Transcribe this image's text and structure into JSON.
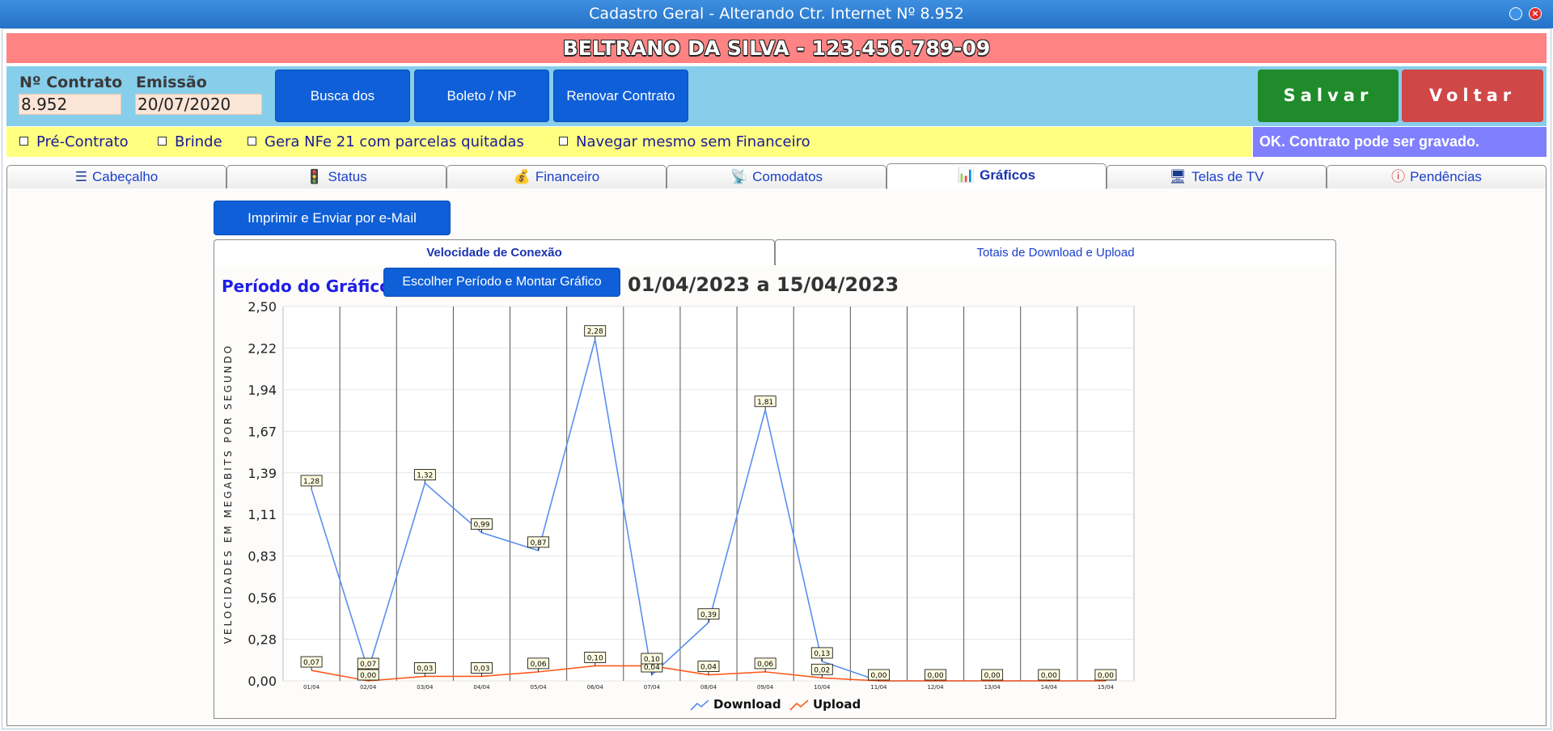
{
  "window": {
    "title": "Cadastro Geral - Alterando Ctr. Internet Nº 8.952"
  },
  "customer": {
    "name": "BELTRANO DA SILVA - 123.456.789-09"
  },
  "contract": {
    "number_label": "Nº Contrato",
    "number": "8.952",
    "issue_label": "Emissão",
    "issue_date": "20/07/2020"
  },
  "actions": {
    "busca": "Busca dos Comodatos",
    "boleto": "Boleto / NP Comodatos",
    "renovar": "Renovar Contrato",
    "salvar": "Salvar",
    "voltar": "Voltar"
  },
  "options": {
    "pre_contrato": "Pré-Contrato",
    "brinde": "Brinde",
    "gera_nfe": "Gera NFe 21 com parcelas quitadas",
    "navegar": "Navegar mesmo sem Financeiro"
  },
  "status_message": "OK. Contrato pode ser gravado.",
  "tabs": {
    "cabecalho": "Cabeçalho",
    "status": "Status",
    "financeiro": "Financeiro",
    "comodatos": "Comodatos",
    "graficos": "Gráficos",
    "telas": "Telas de TV",
    "pendencias": "Pendências"
  },
  "graficos": {
    "print_button": "Imprimir e Enviar por e-Mail",
    "subtab_velocidade": "Velocidade de Conexão",
    "subtab_totais": "Totais de Download e Upload",
    "period_label": "Período do Gráfico:",
    "period_button": "Escolher Período e Montar Gráfico",
    "period_range": "01/04/2023 a 15/04/2023"
  },
  "chart_data": {
    "type": "line",
    "ylabel": "VELOCIDADES EM MEGABITS POR SEGUNDO",
    "ylim": [
      0,
      2.5
    ],
    "yticks": [
      "0,00",
      "0,28",
      "0,56",
      "0,83",
      "1,11",
      "1,39",
      "1,67",
      "1,94",
      "2,22",
      "2,50"
    ],
    "categories": [
      "01/04",
      "02/04",
      "03/04",
      "04/04",
      "05/04",
      "06/04",
      "07/04",
      "08/04",
      "09/04",
      "10/04",
      "11/04",
      "12/04",
      "13/04",
      "14/04",
      "15/04"
    ],
    "series": [
      {
        "name": "Download",
        "color": "#5b8ef0",
        "values": [
          1.28,
          0.07,
          1.32,
          0.99,
          0.87,
          2.28,
          0.04,
          0.39,
          1.81,
          0.13,
          0.0,
          0.0,
          0.0,
          0.0,
          0.0
        ],
        "labels": [
          "1,28",
          "0,07",
          "1,32",
          "0,99",
          "0,87",
          "2,28",
          "0,04",
          "0,39",
          "1,81",
          "0,13",
          "0,00",
          "0,00",
          "0,00",
          "0,00",
          "0,00"
        ]
      },
      {
        "name": "Upload",
        "color": "#ff5a1a",
        "values": [
          0.07,
          0.0,
          0.03,
          0.03,
          0.06,
          0.1,
          0.1,
          0.04,
          0.06,
          0.02,
          0.0,
          0.0,
          0.0,
          0.0,
          0.0
        ],
        "labels": [
          "0,07",
          "0,00",
          "0,03",
          "0,03",
          "0,06",
          "0,10",
          "0,10",
          "0,04",
          "0,06",
          "0,02"
        ]
      }
    ],
    "grid": true,
    "legend": "bottom-center"
  }
}
